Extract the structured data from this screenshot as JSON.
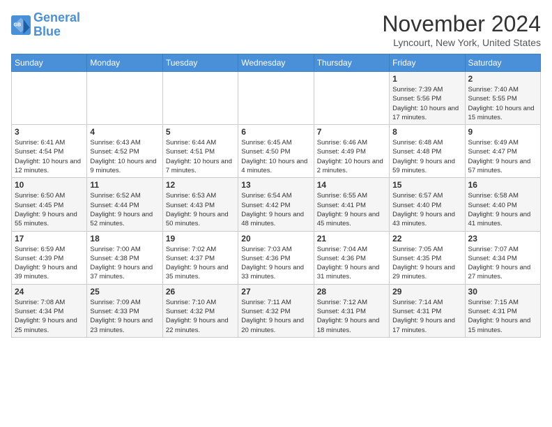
{
  "logo": {
    "line1": "General",
    "line2": "Blue"
  },
  "title": "November 2024",
  "location": "Lyncourt, New York, United States",
  "days_of_week": [
    "Sunday",
    "Monday",
    "Tuesday",
    "Wednesday",
    "Thursday",
    "Friday",
    "Saturday"
  ],
  "weeks": [
    [
      {
        "day": "",
        "info": ""
      },
      {
        "day": "",
        "info": ""
      },
      {
        "day": "",
        "info": ""
      },
      {
        "day": "",
        "info": ""
      },
      {
        "day": "",
        "info": ""
      },
      {
        "day": "1",
        "info": "Sunrise: 7:39 AM\nSunset: 5:56 PM\nDaylight: 10 hours and 17 minutes."
      },
      {
        "day": "2",
        "info": "Sunrise: 7:40 AM\nSunset: 5:55 PM\nDaylight: 10 hours and 15 minutes."
      }
    ],
    [
      {
        "day": "3",
        "info": "Sunrise: 6:41 AM\nSunset: 4:54 PM\nDaylight: 10 hours and 12 minutes."
      },
      {
        "day": "4",
        "info": "Sunrise: 6:43 AM\nSunset: 4:52 PM\nDaylight: 10 hours and 9 minutes."
      },
      {
        "day": "5",
        "info": "Sunrise: 6:44 AM\nSunset: 4:51 PM\nDaylight: 10 hours and 7 minutes."
      },
      {
        "day": "6",
        "info": "Sunrise: 6:45 AM\nSunset: 4:50 PM\nDaylight: 10 hours and 4 minutes."
      },
      {
        "day": "7",
        "info": "Sunrise: 6:46 AM\nSunset: 4:49 PM\nDaylight: 10 hours and 2 minutes."
      },
      {
        "day": "8",
        "info": "Sunrise: 6:48 AM\nSunset: 4:48 PM\nDaylight: 9 hours and 59 minutes."
      },
      {
        "day": "9",
        "info": "Sunrise: 6:49 AM\nSunset: 4:47 PM\nDaylight: 9 hours and 57 minutes."
      }
    ],
    [
      {
        "day": "10",
        "info": "Sunrise: 6:50 AM\nSunset: 4:45 PM\nDaylight: 9 hours and 55 minutes."
      },
      {
        "day": "11",
        "info": "Sunrise: 6:52 AM\nSunset: 4:44 PM\nDaylight: 9 hours and 52 minutes."
      },
      {
        "day": "12",
        "info": "Sunrise: 6:53 AM\nSunset: 4:43 PM\nDaylight: 9 hours and 50 minutes."
      },
      {
        "day": "13",
        "info": "Sunrise: 6:54 AM\nSunset: 4:42 PM\nDaylight: 9 hours and 48 minutes."
      },
      {
        "day": "14",
        "info": "Sunrise: 6:55 AM\nSunset: 4:41 PM\nDaylight: 9 hours and 45 minutes."
      },
      {
        "day": "15",
        "info": "Sunrise: 6:57 AM\nSunset: 4:40 PM\nDaylight: 9 hours and 43 minutes."
      },
      {
        "day": "16",
        "info": "Sunrise: 6:58 AM\nSunset: 4:40 PM\nDaylight: 9 hours and 41 minutes."
      }
    ],
    [
      {
        "day": "17",
        "info": "Sunrise: 6:59 AM\nSunset: 4:39 PM\nDaylight: 9 hours and 39 minutes."
      },
      {
        "day": "18",
        "info": "Sunrise: 7:00 AM\nSunset: 4:38 PM\nDaylight: 9 hours and 37 minutes."
      },
      {
        "day": "19",
        "info": "Sunrise: 7:02 AM\nSunset: 4:37 PM\nDaylight: 9 hours and 35 minutes."
      },
      {
        "day": "20",
        "info": "Sunrise: 7:03 AM\nSunset: 4:36 PM\nDaylight: 9 hours and 33 minutes."
      },
      {
        "day": "21",
        "info": "Sunrise: 7:04 AM\nSunset: 4:36 PM\nDaylight: 9 hours and 31 minutes."
      },
      {
        "day": "22",
        "info": "Sunrise: 7:05 AM\nSunset: 4:35 PM\nDaylight: 9 hours and 29 minutes."
      },
      {
        "day": "23",
        "info": "Sunrise: 7:07 AM\nSunset: 4:34 PM\nDaylight: 9 hours and 27 minutes."
      }
    ],
    [
      {
        "day": "24",
        "info": "Sunrise: 7:08 AM\nSunset: 4:34 PM\nDaylight: 9 hours and 25 minutes."
      },
      {
        "day": "25",
        "info": "Sunrise: 7:09 AM\nSunset: 4:33 PM\nDaylight: 9 hours and 23 minutes."
      },
      {
        "day": "26",
        "info": "Sunrise: 7:10 AM\nSunset: 4:32 PM\nDaylight: 9 hours and 22 minutes."
      },
      {
        "day": "27",
        "info": "Sunrise: 7:11 AM\nSunset: 4:32 PM\nDaylight: 9 hours and 20 minutes."
      },
      {
        "day": "28",
        "info": "Sunrise: 7:12 AM\nSunset: 4:31 PM\nDaylight: 9 hours and 18 minutes."
      },
      {
        "day": "29",
        "info": "Sunrise: 7:14 AM\nSunset: 4:31 PM\nDaylight: 9 hours and 17 minutes."
      },
      {
        "day": "30",
        "info": "Sunrise: 7:15 AM\nSunset: 4:31 PM\nDaylight: 9 hours and 15 minutes."
      }
    ]
  ]
}
